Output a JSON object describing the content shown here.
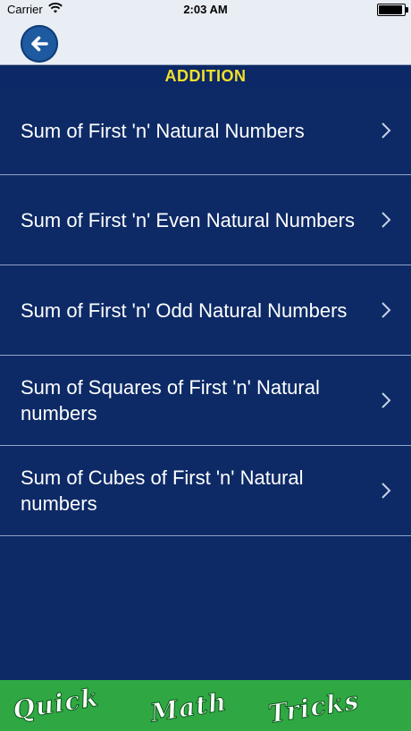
{
  "status_bar": {
    "carrier": "Carrier",
    "time": "2:03 AM"
  },
  "header": {
    "title": "ADDITION"
  },
  "list": {
    "items": [
      {
        "label": "Sum of First 'n' Natural Numbers"
      },
      {
        "label": "Sum of First 'n' Even Natural Numbers"
      },
      {
        "label": "Sum of First 'n' Odd Natural Numbers"
      },
      {
        "label": "Sum of Squares of First 'n' Natural numbers"
      },
      {
        "label": "Sum of Cubes of First 'n' Natural numbers"
      }
    ]
  },
  "banner": {
    "words": [
      "Quick",
      "Math",
      "Tricks"
    ]
  },
  "colors": {
    "background": "#0d2a66",
    "header_text": "#f2e02b",
    "banner_green": "#2fa843",
    "back_button": "#1e5aa0"
  },
  "icons": {
    "back": "back-arrow-icon",
    "chevron": "chevron-right-icon",
    "wifi": "wifi-icon",
    "battery": "battery-icon"
  }
}
